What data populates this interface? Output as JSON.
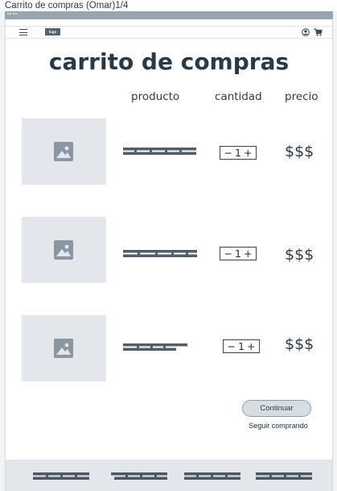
{
  "window": {
    "title": "Carrito de compras (Omar)1/4"
  },
  "topnav": {
    "logo_label": "logo",
    "menu_icon": "hamburger-icon",
    "user_icon": "user-icon",
    "cart_icon": "cart-icon"
  },
  "page": {
    "title": "carrito de compras"
  },
  "columns": {
    "product": "producto",
    "quantity": "cantidad",
    "price": "precio"
  },
  "items": [
    {
      "image_icon": "image-placeholder-icon",
      "quantity": "1",
      "minus": "−",
      "plus": "+",
      "price": "$$$"
    },
    {
      "image_icon": "image-placeholder-icon",
      "quantity": "1",
      "minus": "−",
      "plus": "+",
      "price": "$$$"
    },
    {
      "image_icon": "image-placeholder-icon",
      "quantity": "1",
      "minus": "−",
      "plus": "+",
      "price": "$$$"
    }
  ],
  "actions": {
    "continue_label": "Continuar",
    "keep_shopping_label": "Seguir comprando"
  },
  "colors": {
    "placeholder_bg": "#e3e6ea",
    "text_dark": "#2b3845",
    "frame_gray": "#9aa4ae",
    "button_bg": "#d8dde2"
  }
}
